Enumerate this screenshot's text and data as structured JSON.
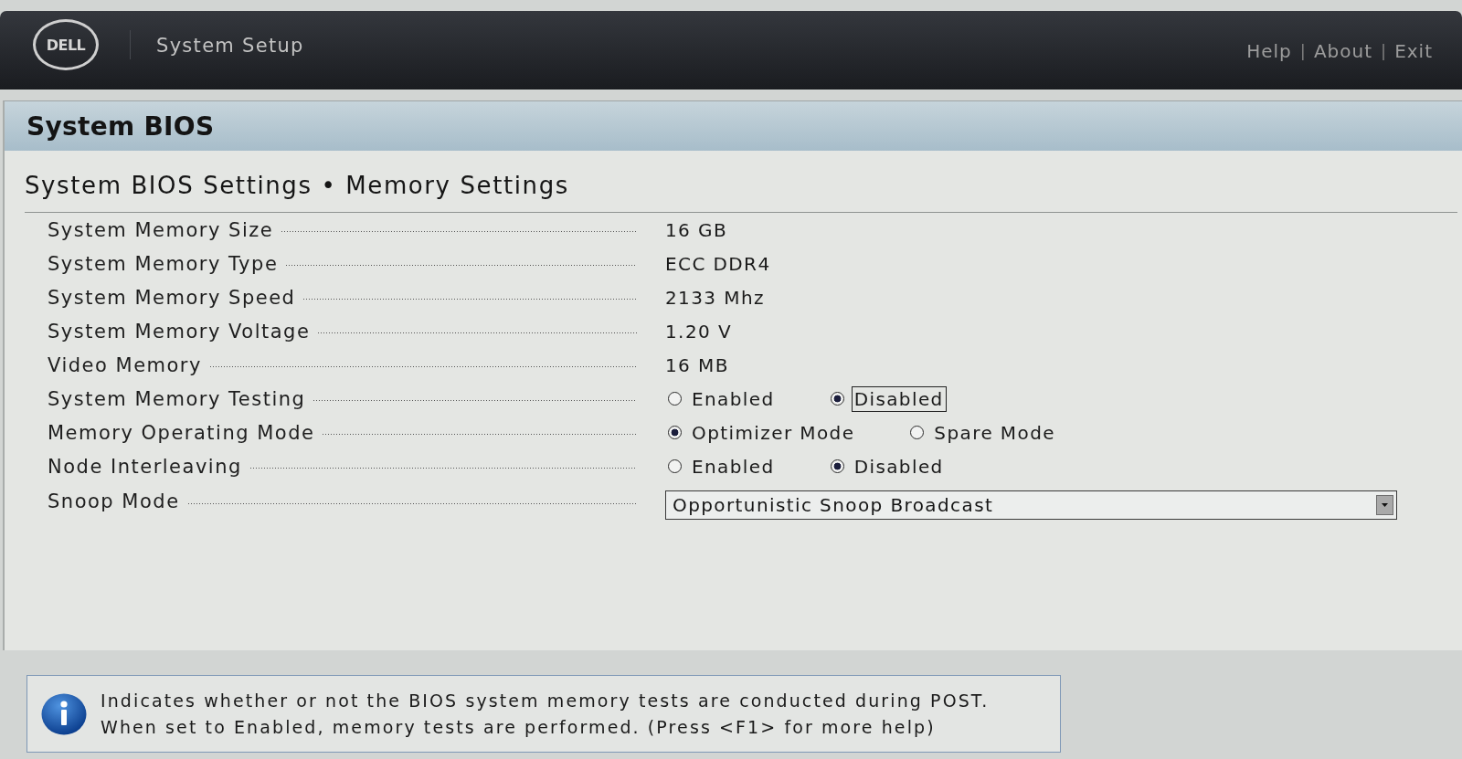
{
  "header": {
    "logo_text": "DELL",
    "title": "System Setup",
    "links": [
      "Help",
      "About",
      "Exit"
    ],
    "separators": [
      "|",
      "|"
    ]
  },
  "page": {
    "title": "System BIOS",
    "subtitle": "System BIOS Settings • Memory Settings"
  },
  "settings": [
    {
      "kind": "value",
      "label": "System Memory Size",
      "value": "16 GB"
    },
    {
      "kind": "value",
      "label": "System Memory Type",
      "value": "ECC DDR4"
    },
    {
      "kind": "value",
      "label": "System Memory Speed",
      "value": "2133 Mhz"
    },
    {
      "kind": "value",
      "label": "System Memory Voltage",
      "value": "1.20 V"
    },
    {
      "kind": "value",
      "label": "Video Memory",
      "value": "16 MB"
    },
    {
      "kind": "radio",
      "label": "System Memory Testing",
      "options": [
        {
          "label": "Enabled",
          "selected": false,
          "focused": false
        },
        {
          "label": "Disabled",
          "selected": true,
          "focused": true
        }
      ]
    },
    {
      "kind": "radio",
      "label": "Memory Operating Mode",
      "options": [
        {
          "label": "Optimizer Mode",
          "selected": true,
          "focused": false
        },
        {
          "label": "Spare Mode",
          "selected": false,
          "focused": false
        }
      ]
    },
    {
      "kind": "radio",
      "label": "Node Interleaving",
      "options": [
        {
          "label": "Enabled",
          "selected": false,
          "focused": false
        },
        {
          "label": "Disabled",
          "selected": true,
          "focused": false
        }
      ]
    },
    {
      "kind": "dropdown",
      "label": "Snoop Mode",
      "value": "Opportunistic Snoop Broadcast"
    }
  ],
  "help": {
    "text": "Indicates whether or not the BIOS system memory tests are conducted during POST.\nWhen set to Enabled, memory tests are performed. (Press <F1> for more help)"
  }
}
